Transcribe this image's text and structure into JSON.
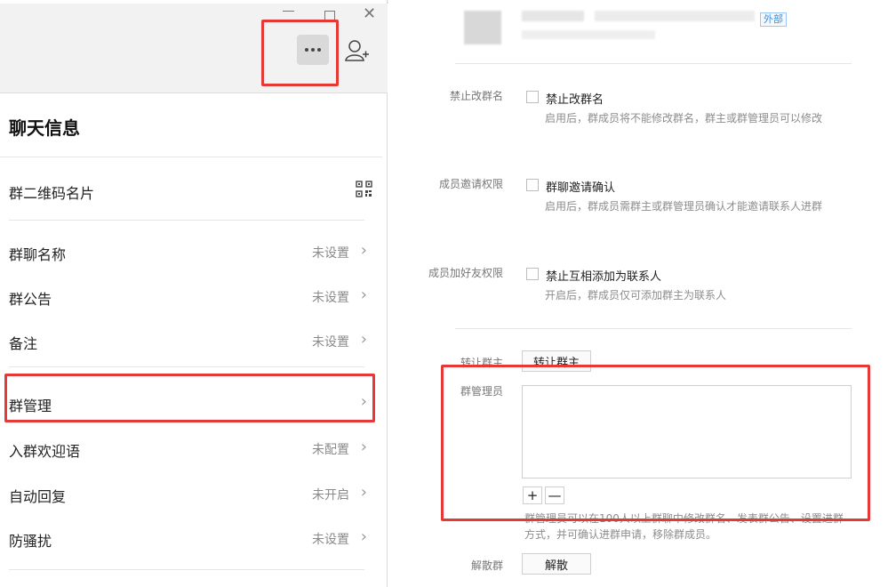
{
  "chat_info": {
    "title": "聊天信息",
    "qr_card_label": "群二维码名片",
    "rows": [
      {
        "label": "群聊名称",
        "value": "未设置"
      },
      {
        "label": "群公告",
        "value": "未设置"
      },
      {
        "label": "备注",
        "value": "未设置"
      },
      {
        "label": "群管理",
        "value": ""
      },
      {
        "label": "入群欢迎语",
        "value": "未配置"
      },
      {
        "label": "自动回复",
        "value": "未开启"
      },
      {
        "label": "防骚扰",
        "value": "未设置"
      }
    ],
    "chevron": "›"
  },
  "window": {
    "min": "—",
    "close": "✕"
  },
  "group_settings": {
    "external_tag": "外部",
    "rename": {
      "label": "禁止改群名",
      "option": "禁止改群名",
      "desc": "启用后，群成员将不能修改群名，群主或群管理员可以修改"
    },
    "invite": {
      "label": "成员邀请权限",
      "option": "群聊邀请确认",
      "desc": "启用后，群成员需群主或群管理员确认才能邀请联系人进群"
    },
    "friend": {
      "label": "成员加好友权限",
      "option": "禁止互相添加为联系人",
      "desc": "开启后，群成员仅可添加群主为联系人"
    },
    "transfer": {
      "label": "转让群主",
      "button": "转让群主"
    },
    "admins": {
      "label": "群管理员",
      "add": "+",
      "remove": "—",
      "note": "群管理员可以在100人以上群聊中修改群名、发表群公告、设置进群方式，并可确认进群申请，移除群成员。"
    },
    "dismiss": {
      "label": "解散群",
      "button": "解散"
    }
  },
  "colors": {
    "highlight": "#e53935",
    "tag": "#3a8ee6"
  }
}
